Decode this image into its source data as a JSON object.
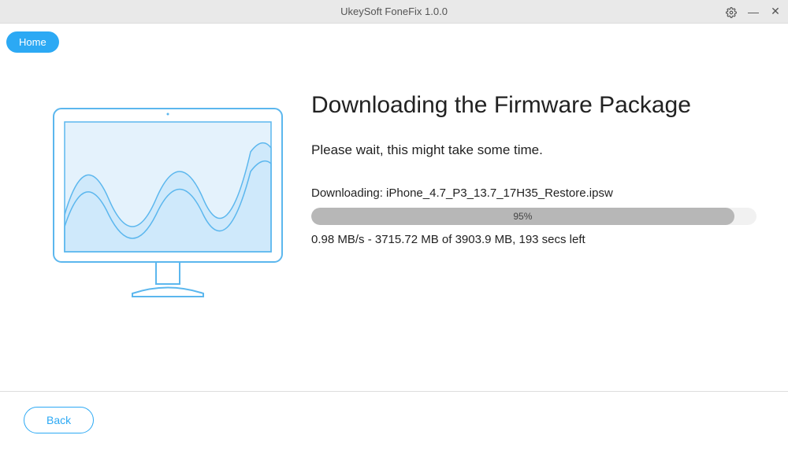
{
  "titlebar": {
    "title": "UkeySoft FoneFix 1.0.0"
  },
  "toolbar": {
    "home_label": "Home"
  },
  "main": {
    "heading": "Downloading the Firmware Package",
    "subtext": "Please wait, this might take some time.",
    "filename": "Downloading: iPhone_4.7_P3_13.7_17H35_Restore.ipsw",
    "progress_percent": "95%",
    "progress_width": 95,
    "stats": "0.98 MB/s - 3715.72 MB of 3903.9 MB, 193 secs left"
  },
  "footer": {
    "back_label": "Back"
  }
}
